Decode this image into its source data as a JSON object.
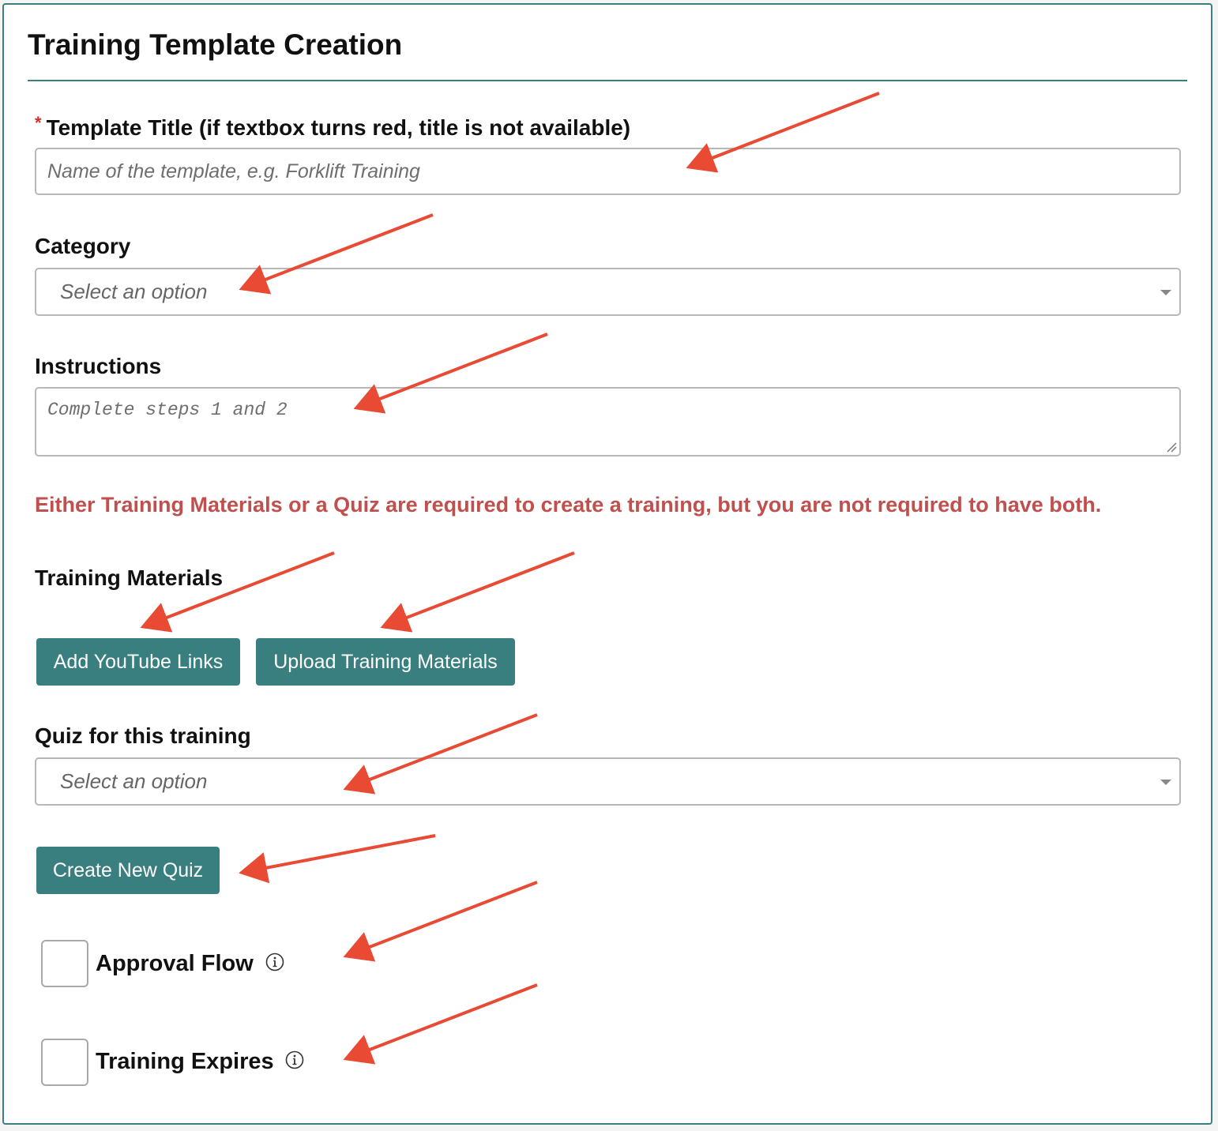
{
  "page": {
    "title": "Training Template Creation"
  },
  "template_title": {
    "required_marker": "*",
    "label": "Template Title (if textbox turns red, title is not available)",
    "placeholder": "Name of the template, e.g. Forklift Training",
    "value": ""
  },
  "category": {
    "label": "Category",
    "selected": "Select an option"
  },
  "instructions": {
    "label": "Instructions",
    "placeholder": "Complete steps 1 and 2"
  },
  "notice": {
    "text": "Either Training Materials or a Quiz are required to create a training, but you are not required to have both.",
    "color": "#c0504d"
  },
  "training_materials": {
    "label": "Training Materials",
    "add_youtube_label": "Add YouTube Links",
    "upload_label": "Upload Training Materials"
  },
  "quiz": {
    "label": "Quiz for this training",
    "selected": "Select an option",
    "create_label": "Create New Quiz"
  },
  "options": {
    "approval_flow_label": "Approval Flow",
    "training_expires_label": "Training Expires",
    "info_icon": "info-circle-icon"
  },
  "colors": {
    "accent": "#3a7f7f",
    "annotation_arrow": "#e84a33"
  }
}
